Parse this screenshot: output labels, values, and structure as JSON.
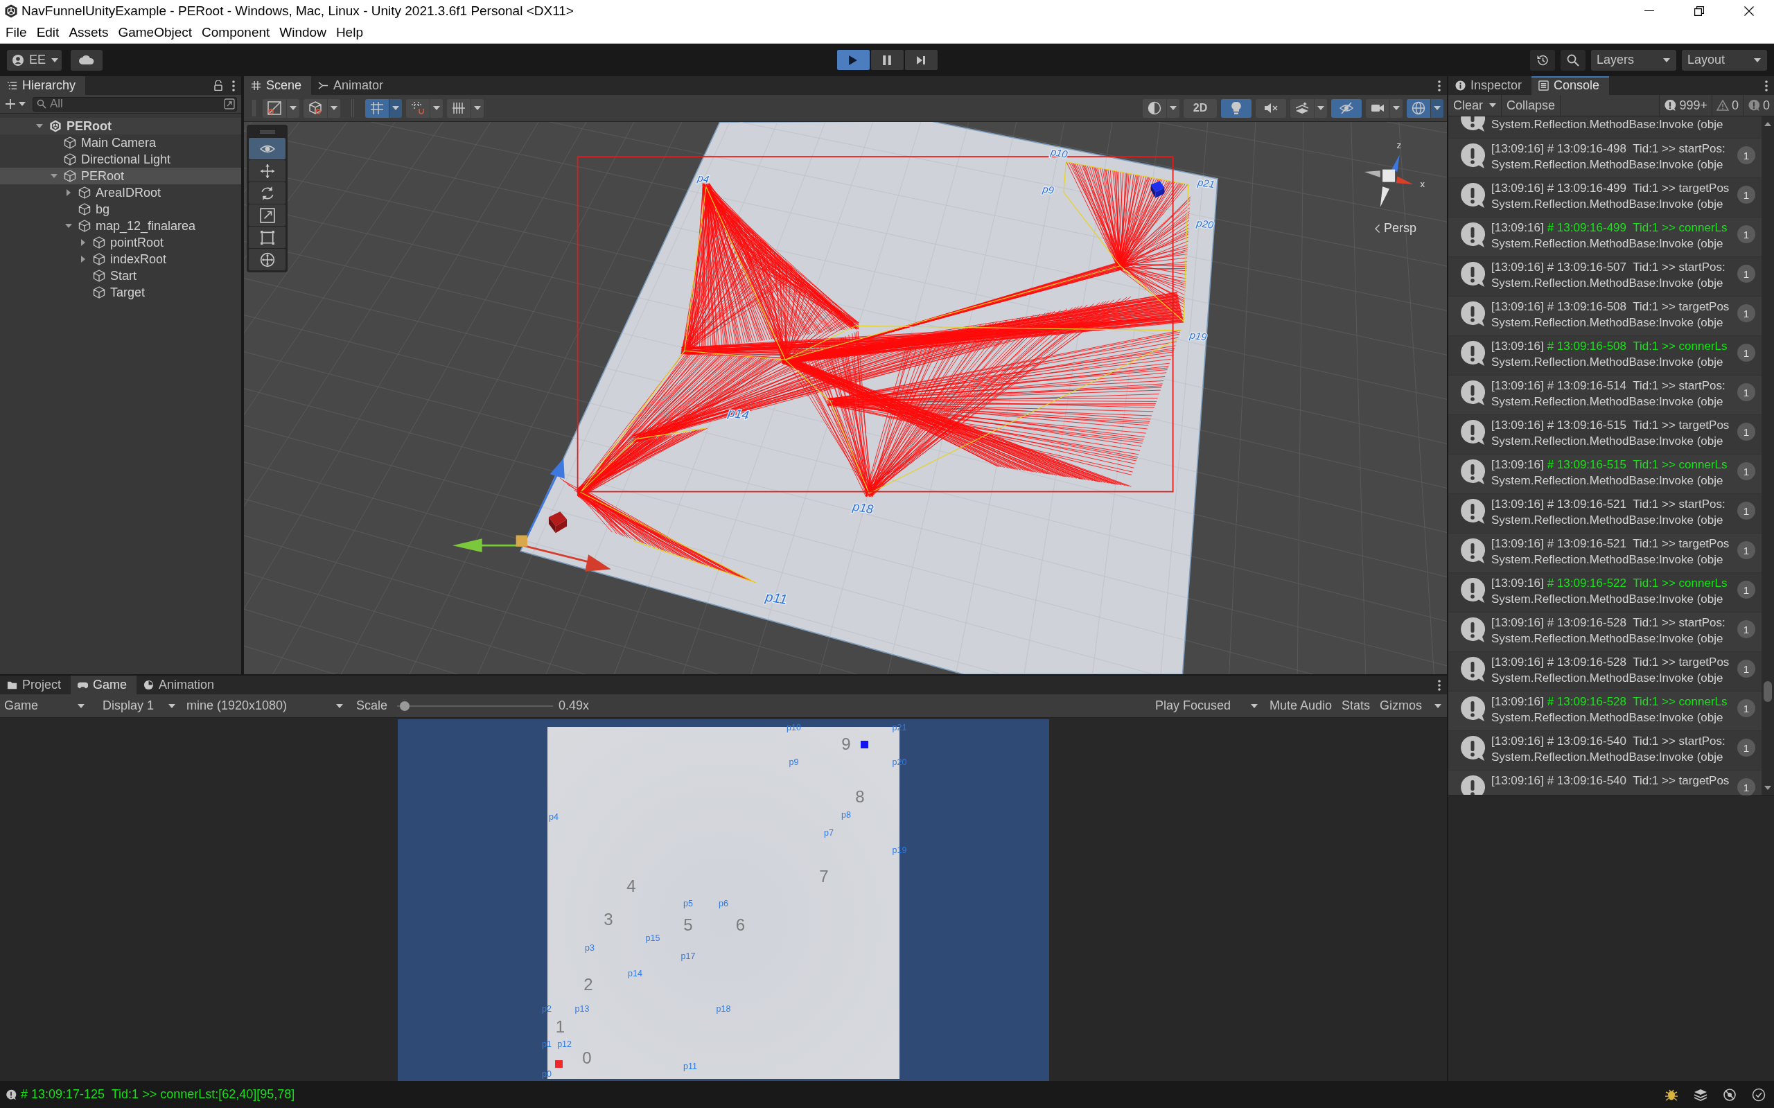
{
  "window": {
    "title": "NavFunnelUnityExample - PERoot - Windows, Mac, Linux - Unity 2021.3.6f1 Personal <DX11>"
  },
  "menu": [
    "File",
    "Edit",
    "Assets",
    "GameObject",
    "Component",
    "Window",
    "Help"
  ],
  "toolbar": {
    "account": "EE",
    "play": {
      "playing": true,
      "paused": false
    },
    "layers": "Layers",
    "layout": "Layout"
  },
  "hierarchy": {
    "tab": "Hierarchy",
    "search": {
      "placeholder": "All"
    },
    "tree": [
      {
        "label": "PERoot",
        "kind": "scene",
        "expanded": true,
        "selected": false,
        "children": [
          {
            "label": "Main Camera",
            "kind": "object",
            "selected": false
          },
          {
            "label": "Directional Light",
            "kind": "object",
            "selected": false
          },
          {
            "label": "PERoot",
            "kind": "group",
            "expanded": true,
            "selected": true,
            "children": [
              {
                "label": "AreaIDRoot",
                "kind": "group",
                "expanded": false,
                "selected": false
              },
              {
                "label": "bg",
                "kind": "object",
                "selected": false
              },
              {
                "label": "map_12_finalarea",
                "kind": "group",
                "expanded": true,
                "selected": false,
                "children": [
                  {
                    "label": "pointRoot",
                    "kind": "group",
                    "expanded": false,
                    "selected": false
                  },
                  {
                    "label": "indexRoot",
                    "kind": "group",
                    "expanded": false,
                    "selected": false
                  },
                  {
                    "label": "Start",
                    "kind": "object",
                    "selected": false
                  },
                  {
                    "label": "Target",
                    "kind": "object",
                    "selected": false
                  }
                ]
              }
            ]
          }
        ]
      }
    ]
  },
  "scene": {
    "tabs": [
      {
        "label": "Scene",
        "kind": "scene",
        "selected": true
      },
      {
        "label": "Animator",
        "kind": "animator",
        "selected": false
      }
    ],
    "left_tools": [
      {
        "kind": "drawmode",
        "on": false
      },
      {
        "kind": "render",
        "on": false
      },
      {
        "kind": "snap",
        "on": true
      },
      {
        "kind": "increment",
        "on": false
      },
      {
        "kind": "grid",
        "on": false
      }
    ],
    "right_tools": [
      {
        "kind": "shading",
        "on": false
      },
      {
        "kind": "dimension",
        "label": "2D",
        "on": false
      },
      {
        "kind": "lighting",
        "on": true
      },
      {
        "kind": "audio",
        "on": false
      },
      {
        "kind": "effects",
        "on": false
      },
      {
        "kind": "visibility",
        "on": true
      },
      {
        "kind": "camera",
        "on": false
      },
      {
        "kind": "gizmos",
        "on": true
      }
    ],
    "tools": [
      {
        "kind": "view",
        "selected": true
      },
      {
        "kind": "move",
        "selected": false
      },
      {
        "kind": "rotate",
        "selected": false
      },
      {
        "kind": "scale",
        "selected": false
      },
      {
        "kind": "rect",
        "selected": false
      },
      {
        "kind": "transform",
        "selected": false
      }
    ],
    "labels": [
      "p10",
      "p4",
      "p21",
      "p9",
      "p20",
      "p19",
      "p14",
      "p18",
      "p11"
    ],
    "axes": [
      "z",
      "x"
    ],
    "projection": "Persp"
  },
  "console": {
    "tabs": [
      {
        "label": "Inspector",
        "kind": "inspector",
        "selected": false
      },
      {
        "label": "Console",
        "kind": "console",
        "selected": true
      }
    ],
    "clear": "Clear",
    "collapse": "Collapse",
    "counts": {
      "info": "999+",
      "warning": "0",
      "error": "0"
    },
    "rows": [
      {
        "kind": "tail",
        "detail": "System.Reflection.MethodBase:Invoke (obje"
      },
      {
        "kind": "full",
        "time": "[13:09:16]",
        "message": "# 13:09:16-498  Tid:1 >> startPos:",
        "detail": "System.Reflection.MethodBase:Invoke (obje",
        "count": "1",
        "color": "#d2d2d2"
      },
      {
        "kind": "full",
        "time": "[13:09:16]",
        "message": "# 13:09:16-499  Tid:1 >> targetPos",
        "detail": "System.Reflection.MethodBase:Invoke (obje",
        "count": "1",
        "color": "#d2d2d2"
      },
      {
        "kind": "full",
        "time": "[13:09:16]",
        "message": "# 13:09:16-499  Tid:1 >> connerLs",
        "detail": "System.Reflection.MethodBase:Invoke (obje",
        "count": "1",
        "color": "#14e614"
      },
      {
        "kind": "full",
        "time": "[13:09:16]",
        "message": "# 13:09:16-507  Tid:1 >> startPos:",
        "detail": "System.Reflection.MethodBase:Invoke (obje",
        "count": "1",
        "color": "#d2d2d2"
      },
      {
        "kind": "full",
        "time": "[13:09:16]",
        "message": "# 13:09:16-508  Tid:1 >> targetPos",
        "detail": "System.Reflection.MethodBase:Invoke (obje",
        "count": "1",
        "color": "#d2d2d2"
      },
      {
        "kind": "full",
        "time": "[13:09:16]",
        "message": "# 13:09:16-508  Tid:1 >> connerLs",
        "detail": "System.Reflection.MethodBase:Invoke (obje",
        "count": "1",
        "color": "#14e614"
      },
      {
        "kind": "full",
        "time": "[13:09:16]",
        "message": "# 13:09:16-514  Tid:1 >> startPos:",
        "detail": "System.Reflection.MethodBase:Invoke (obje",
        "count": "1",
        "color": "#d2d2d2"
      },
      {
        "kind": "full",
        "time": "[13:09:16]",
        "message": "# 13:09:16-515  Tid:1 >> targetPos",
        "detail": "System.Reflection.MethodBase:Invoke (obje",
        "count": "1",
        "color": "#d2d2d2"
      },
      {
        "kind": "full",
        "time": "[13:09:16]",
        "message": "# 13:09:16-515  Tid:1 >> connerLs",
        "detail": "System.Reflection.MethodBase:Invoke (obje",
        "count": "1",
        "color": "#14e614"
      },
      {
        "kind": "full",
        "time": "[13:09:16]",
        "message": "# 13:09:16-521  Tid:1 >> startPos:",
        "detail": "System.Reflection.MethodBase:Invoke (obje",
        "count": "1",
        "color": "#d2d2d2"
      },
      {
        "kind": "full",
        "time": "[13:09:16]",
        "message": "# 13:09:16-521  Tid:1 >> targetPos",
        "detail": "System.Reflection.MethodBase:Invoke (obje",
        "count": "1",
        "color": "#d2d2d2"
      },
      {
        "kind": "full",
        "time": "[13:09:16]",
        "message": "# 13:09:16-522  Tid:1 >> connerLs",
        "detail": "System.Reflection.MethodBase:Invoke (obje",
        "count": "1",
        "color": "#14e614"
      },
      {
        "kind": "full",
        "time": "[13:09:16]",
        "message": "# 13:09:16-528  Tid:1 >> startPos:",
        "detail": "System.Reflection.MethodBase:Invoke (obje",
        "count": "1",
        "color": "#d2d2d2"
      },
      {
        "kind": "full",
        "time": "[13:09:16]",
        "message": "# 13:09:16-528  Tid:1 >> targetPos",
        "detail": "System.Reflection.MethodBase:Invoke (obje",
        "count": "1",
        "color": "#d2d2d2"
      },
      {
        "kind": "full",
        "time": "[13:09:16]",
        "message": "# 13:09:16-528  Tid:1 >> connerLs",
        "detail": "System.Reflection.MethodBase:Invoke (obje",
        "count": "1",
        "color": "#14e614"
      },
      {
        "kind": "full",
        "time": "[13:09:16]",
        "message": "# 13:09:16-540  Tid:1 >> startPos:",
        "detail": "System.Reflection.MethodBase:Invoke (obje",
        "count": "1",
        "color": "#d2d2d2"
      },
      {
        "kind": "head",
        "time": "[13:09:16]",
        "message": "# 13:09:16-540  Tid:1 >> targetPos",
        "count": "1",
        "color": "#d2d2d2"
      }
    ]
  },
  "game": {
    "tabs": [
      {
        "label": "Project",
        "kind": "project",
        "selected": false
      },
      {
        "label": "Game",
        "kind": "game",
        "selected": true
      },
      {
        "label": "Animation",
        "kind": "animation",
        "selected": false
      }
    ],
    "toolbar": {
      "view": "Game",
      "display": "Display 1",
      "resolution": "mine (1920x1080)",
      "scale_label": "Scale",
      "scale": {
        "level": 0.02
      },
      "scale_value": "0.49x",
      "play_mode": "Play Focused",
      "mute": "Mute Audio",
      "stats": "Stats",
      "gizmos": "Gizmos"
    },
    "labels": [
      {
        "text": "p10",
        "kind": "point"
      },
      {
        "text": "p21",
        "kind": "point"
      },
      {
        "text": "9",
        "kind": "area"
      },
      {
        "text": "p9",
        "kind": "point"
      },
      {
        "text": "p20",
        "kind": "point"
      },
      {
        "text": "8",
        "kind": "area"
      },
      {
        "text": "p8",
        "kind": "point"
      },
      {
        "text": "p4",
        "kind": "point"
      },
      {
        "text": "p7",
        "kind": "point"
      },
      {
        "text": "p19",
        "kind": "point"
      },
      {
        "text": "7",
        "kind": "area"
      },
      {
        "text": "4",
        "kind": "area"
      },
      {
        "text": "p5",
        "kind": "point"
      },
      {
        "text": "p6",
        "kind": "point"
      },
      {
        "text": "3",
        "kind": "area"
      },
      {
        "text": "5",
        "kind": "area"
      },
      {
        "text": "6",
        "kind": "area"
      },
      {
        "text": "p15",
        "kind": "point"
      },
      {
        "text": "p3",
        "kind": "point"
      },
      {
        "text": "p17",
        "kind": "point"
      },
      {
        "text": "p14",
        "kind": "point"
      },
      {
        "text": "2",
        "kind": "area"
      },
      {
        "text": "p2",
        "kind": "point"
      },
      {
        "text": "p13",
        "kind": "point"
      },
      {
        "text": "p18",
        "kind": "point"
      },
      {
        "text": "1",
        "kind": "area"
      },
      {
        "text": "p1",
        "kind": "point"
      },
      {
        "text": "p12",
        "kind": "point"
      },
      {
        "text": "0",
        "kind": "area"
      },
      {
        "text": "p11",
        "kind": "point"
      },
      {
        "text": "p0",
        "kind": "point"
      }
    ]
  },
  "status_bar": {
    "message": "# 13:09:17-125  Tid:1 >> connerLst:[62,40][95,78]"
  }
}
